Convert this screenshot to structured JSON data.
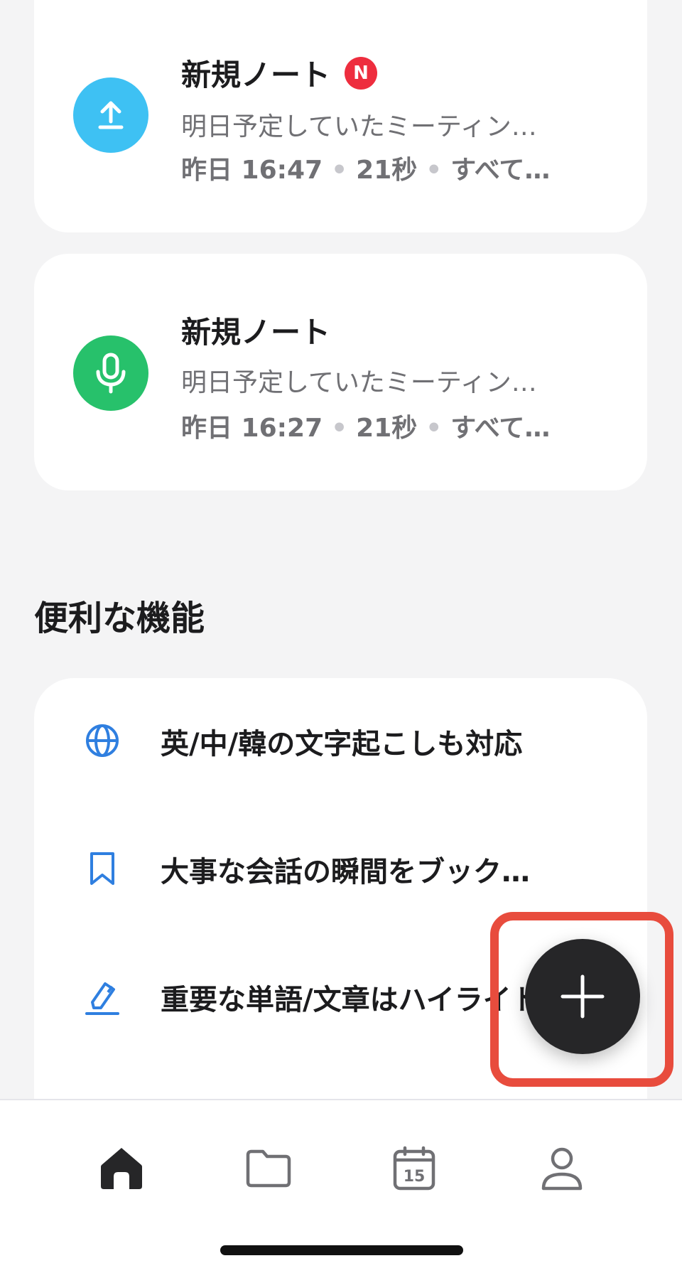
{
  "notes": [
    {
      "title": "新規ノート",
      "badge": "N",
      "snippet": "明日予定していたミーティン…",
      "time": "昨日 16:47",
      "duration": "21秒",
      "scope": "すべて…",
      "icon": "upload-icon",
      "icon_color": "#3ec1f3"
    },
    {
      "title": "新規ノート",
      "snippet": "明日予定していたミーティン…",
      "time": "昨日 16:27",
      "duration": "21秒",
      "scope": "すべて…",
      "icon": "microphone-icon",
      "icon_color": "#27c16b"
    }
  ],
  "features": {
    "title": "便利な機能",
    "items": [
      {
        "label": "英/中/韓の文字起こしも対応",
        "icon": "globe-icon"
      },
      {
        "label": "大事な会話の瞬間をブック…",
        "icon": "bookmark-icon"
      },
      {
        "label": "重要な単語/文章はハイライト",
        "icon": "highlighter-icon"
      }
    ]
  },
  "fab": {
    "icon": "plus-icon",
    "highlight_color": "#e84c3d"
  },
  "tab_bar": {
    "items": [
      {
        "name": "home",
        "icon": "home-icon",
        "active": true
      },
      {
        "name": "folder",
        "icon": "folder-icon",
        "active": false
      },
      {
        "name": "calendar",
        "icon": "calendar-icon",
        "day": "15",
        "active": false
      },
      {
        "name": "profile",
        "icon": "person-icon",
        "active": false
      }
    ]
  },
  "colors": {
    "accent_blue": "#2f7fe0",
    "fab": "#262628"
  }
}
